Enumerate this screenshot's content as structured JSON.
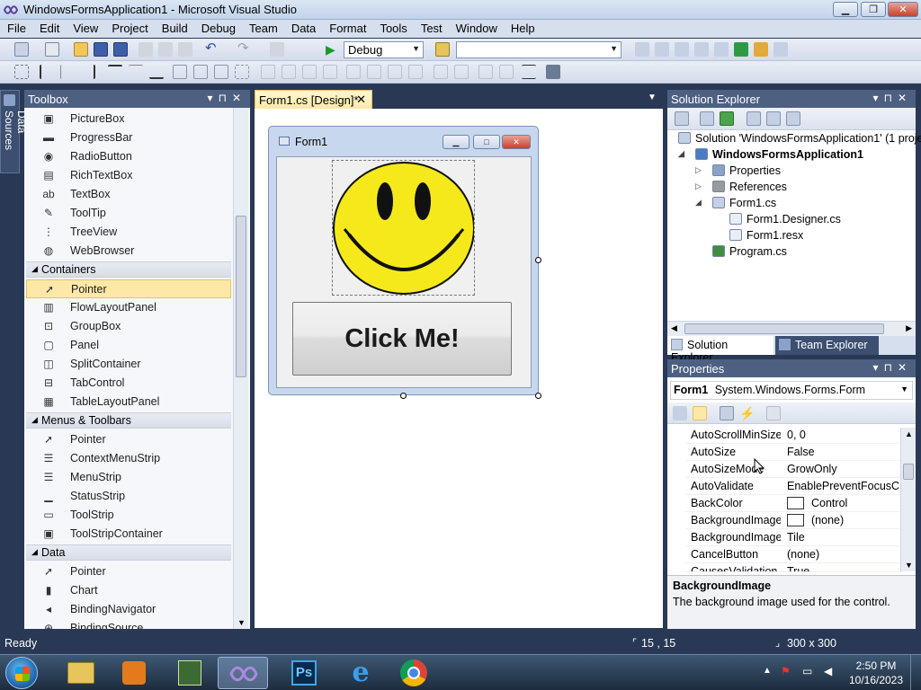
{
  "window": {
    "title": "WindowsFormsApplication1 - Microsoft Visual Studio"
  },
  "menu": [
    "File",
    "Edit",
    "View",
    "Project",
    "Build",
    "Debug",
    "Team",
    "Data",
    "Format",
    "Tools",
    "Test",
    "Window",
    "Help"
  ],
  "toolbar": {
    "config_value": "Debug",
    "platform_value": ""
  },
  "side_tab": {
    "label": "Data Sources"
  },
  "toolbox": {
    "title": "Toolbox",
    "items": [
      {
        "type": "item",
        "label": "PictureBox",
        "icon": "picture-icon"
      },
      {
        "type": "item",
        "label": "ProgressBar",
        "icon": "progressbar-icon"
      },
      {
        "type": "item",
        "label": "RadioButton",
        "icon": "radio-icon"
      },
      {
        "type": "item",
        "label": "RichTextBox",
        "icon": "richtext-icon"
      },
      {
        "type": "item",
        "label": "TextBox",
        "icon": "textbox-icon"
      },
      {
        "type": "item",
        "label": "ToolTip",
        "icon": "tooltip-icon"
      },
      {
        "type": "item",
        "label": "TreeView",
        "icon": "treeview-icon"
      },
      {
        "type": "item",
        "label": "WebBrowser",
        "icon": "globe-icon"
      },
      {
        "type": "group",
        "label": "Containers"
      },
      {
        "type": "item",
        "label": "Pointer",
        "icon": "pointer-icon",
        "selected": true
      },
      {
        "type": "item",
        "label": "FlowLayoutPanel",
        "icon": "flowlayout-icon"
      },
      {
        "type": "item",
        "label": "GroupBox",
        "icon": "groupbox-icon"
      },
      {
        "type": "item",
        "label": "Panel",
        "icon": "panel-icon"
      },
      {
        "type": "item",
        "label": "SplitContainer",
        "icon": "split-icon"
      },
      {
        "type": "item",
        "label": "TabControl",
        "icon": "tab-icon"
      },
      {
        "type": "item",
        "label": "TableLayoutPanel",
        "icon": "table-icon"
      },
      {
        "type": "group",
        "label": "Menus & Toolbars"
      },
      {
        "type": "item",
        "label": "Pointer",
        "icon": "pointer-icon"
      },
      {
        "type": "item",
        "label": "ContextMenuStrip",
        "icon": "contextmenu-icon"
      },
      {
        "type": "item",
        "label": "MenuStrip",
        "icon": "menu-icon"
      },
      {
        "type": "item",
        "label": "StatusStrip",
        "icon": "statusstrip-icon"
      },
      {
        "type": "item",
        "label": "ToolStrip",
        "icon": "toolstrip-icon"
      },
      {
        "type": "item",
        "label": "ToolStripContainer",
        "icon": "toolstripcontainer-icon"
      },
      {
        "type": "group",
        "label": "Data"
      },
      {
        "type": "item",
        "label": "Pointer",
        "icon": "pointer-icon"
      },
      {
        "type": "item",
        "label": "Chart",
        "icon": "chart-icon"
      },
      {
        "type": "item",
        "label": "BindingNavigator",
        "icon": "navigator-icon"
      },
      {
        "type": "item",
        "label": "BindingSource",
        "icon": "bindingsource-icon"
      }
    ]
  },
  "document": {
    "tab_label": "Form1.cs [Design]*",
    "form_title": "Form1",
    "button_text": "Click Me!"
  },
  "solution_explorer": {
    "title": "Solution Explorer",
    "nodes": [
      {
        "label": "Solution 'WindowsFormsApplication1' (1 proje",
        "level": 0,
        "bold": false,
        "expander": ""
      },
      {
        "label": "WindowsFormsApplication1",
        "level": 1,
        "bold": true,
        "expander": "◢"
      },
      {
        "label": "Properties",
        "level": 2,
        "bold": false,
        "expander": "▷"
      },
      {
        "label": "References",
        "level": 2,
        "bold": false,
        "expander": "▷"
      },
      {
        "label": "Form1.cs",
        "level": 2,
        "bold": false,
        "expander": "◢"
      },
      {
        "label": "Form1.Designer.cs",
        "level": 3,
        "bold": false,
        "expander": ""
      },
      {
        "label": "Form1.resx",
        "level": 3,
        "bold": false,
        "expander": ""
      },
      {
        "label": "Program.cs",
        "level": 2,
        "bold": false,
        "expander": ""
      }
    ],
    "tabs": [
      "Solution Explorer",
      "Team Explorer"
    ]
  },
  "properties": {
    "title": "Properties",
    "object_name": "Form1",
    "object_type": "System.Windows.Forms.Form",
    "rows": [
      {
        "name": "AutoScrollMinSize",
        "value": "0, 0",
        "expander": "▷",
        "swatch": false
      },
      {
        "name": "AutoSize",
        "value": "False",
        "expander": "",
        "swatch": false
      },
      {
        "name": "AutoSizeMode",
        "value": "GrowOnly",
        "expander": "",
        "swatch": false
      },
      {
        "name": "AutoValidate",
        "value": "EnablePreventFocusCha",
        "expander": "",
        "swatch": false
      },
      {
        "name": "BackColor",
        "value": "Control",
        "expander": "",
        "swatch": true
      },
      {
        "name": "BackgroundImage",
        "value": "(none)",
        "expander": "",
        "swatch": true
      },
      {
        "name": "BackgroundImageLayout",
        "value": "Tile",
        "expander": "",
        "swatch": false
      },
      {
        "name": "CancelButton",
        "value": "(none)",
        "expander": "",
        "swatch": false
      },
      {
        "name": "CausesValidation",
        "value": "True",
        "expander": "",
        "swatch": false
      }
    ],
    "desc_title": "BackgroundImage",
    "desc_text": "The background image used for the control."
  },
  "status": {
    "left": "Ready",
    "position": "15 , 15",
    "size": "300 x 300"
  },
  "taskbar": {
    "time": "2:50 PM",
    "date": "10/16/2023"
  }
}
